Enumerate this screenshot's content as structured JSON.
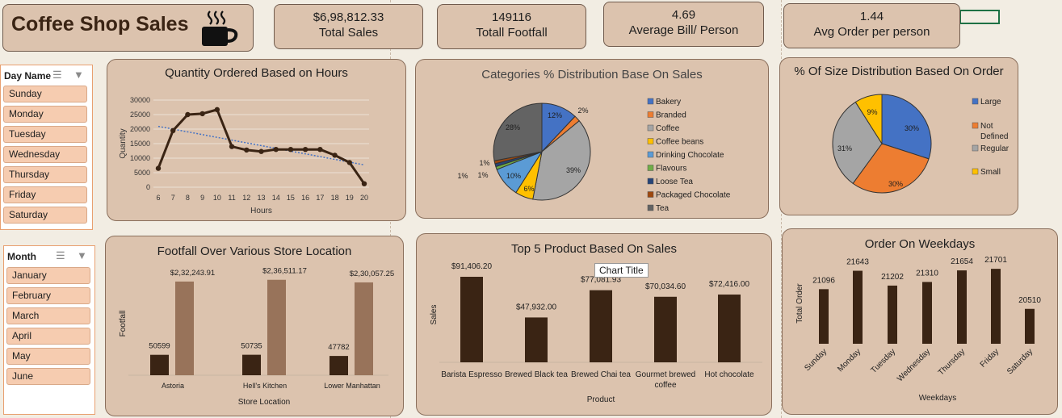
{
  "header": {
    "title": "Coffee Shop Sales",
    "icon": "coffee-cup-icon"
  },
  "kpis": [
    {
      "value": "$6,98,812.33",
      "label": "Total Sales"
    },
    {
      "value": "149116",
      "label": "Totall Footfall"
    },
    {
      "value": "4.69",
      "label": "Average Bill/ Person"
    },
    {
      "value": "1.44",
      "label": "Avg Order per person"
    }
  ],
  "slicers": {
    "day": {
      "title": "Day Name",
      "items": [
        "Sunday",
        "Monday",
        "Tuesday",
        "Wednesday",
        "Thursday",
        "Friday",
        "Saturday"
      ]
    },
    "month": {
      "title": "Month",
      "items": [
        "January",
        "February",
        "March",
        "April",
        "May",
        "June"
      ]
    }
  },
  "tooltip": "Chart Title",
  "chart_data": [
    {
      "type": "line",
      "title": "Quantity Ordered Based on Hours",
      "xlabel": "Hours",
      "ylabel": "Quantity",
      "x": [
        6,
        7,
        8,
        9,
        10,
        11,
        12,
        13,
        14,
        15,
        16,
        17,
        18,
        19,
        20
      ],
      "values": [
        6500,
        19500,
        25000,
        25300,
        26700,
        14000,
        12800,
        12300,
        13000,
        13000,
        13000,
        13000,
        11000,
        8500,
        1200
      ],
      "ylim": [
        0,
        30000
      ],
      "yticks": [
        "0",
        "5000",
        "10000",
        "15000",
        "20000",
        "25000",
        "30000"
      ],
      "trendline": "linear",
      "grid": true
    },
    {
      "type": "pie",
      "title": "Categories % Distribution Base On Sales",
      "legend": "right",
      "labels": [
        "Bakery",
        "Branded",
        "Coffee",
        "Coffee beans",
        "Drinking Chocolate",
        "Flavours",
        "Loose Tea",
        "Packaged Chocolate",
        "Tea"
      ],
      "values": [
        12,
        2,
        39,
        6,
        10,
        1,
        1,
        1,
        28
      ],
      "data_labels": [
        "12%",
        "2%",
        "39%",
        "6%",
        "10%",
        "1%",
        "1%",
        "1%",
        "28%"
      ],
      "colors": [
        "#4472c4",
        "#ed7d31",
        "#a5a5a5",
        "#ffc000",
        "#5b9bd5",
        "#70ad47",
        "#264478",
        "#9e480e",
        "#636363"
      ]
    },
    {
      "type": "pie",
      "title": "% Of Size Distribution Based On Order",
      "legend": "right",
      "labels": [
        "Large",
        "Not Defined",
        "Regular",
        "Small"
      ],
      "values": [
        30,
        30,
        31,
        9
      ],
      "data_labels": [
        "30%",
        "30%",
        "31%",
        "9%"
      ],
      "colors": [
        "#4472c4",
        "#ed7d31",
        "#a5a5a5",
        "#ffc000"
      ]
    },
    {
      "type": "bar",
      "title": "Footfall Over Various Store Location",
      "xlabel": "Store Location",
      "ylabel": "Footfall",
      "categories": [
        "Astoria",
        "Hell's Kitchen",
        "Lower Manhattan"
      ],
      "series": [
        {
          "values": [
            50599,
            50735,
            47782
          ],
          "labels": [
            "50599",
            "50735",
            "47782"
          ],
          "color": "#3a2414"
        },
        {
          "values": [
            232243.91,
            236511.17,
            230057.25
          ],
          "labels": [
            "$2,32,243.91",
            "$2,36,511.17",
            "$2,30,057.25"
          ],
          "color": "#98735a"
        }
      ]
    },
    {
      "type": "bar",
      "title": "Top 5 Product Based On Sales",
      "xlabel": "Product",
      "ylabel": "Sales",
      "categories": [
        "Barista Espresso",
        "Brewed Black tea",
        "Brewed Chai tea",
        "Gourmet brewed coffee",
        "Hot chocolate"
      ],
      "values": [
        91406.2,
        47932.0,
        77081.93,
        70034.6,
        72416.0
      ],
      "data_labels": [
        "$91,406.20",
        "$47,932.00",
        "$77,081.93",
        "$70,034.60",
        "$72,416.00"
      ],
      "color": "#3a2414"
    },
    {
      "type": "bar",
      "title": "Order On Weekdays",
      "xlabel": "Weekdays",
      "ylabel": "Total Order",
      "categories": [
        "Sunday",
        "Monday",
        "Tuesday",
        "Wednesday",
        "Thursday",
        "Friday",
        "Saturday"
      ],
      "values": [
        21096,
        21643,
        21202,
        21310,
        21654,
        21701,
        20510
      ],
      "data_labels": [
        "21096",
        "21643",
        "21202",
        "21310",
        "21654",
        "21701",
        "20510"
      ],
      "color": "#3a2414"
    }
  ]
}
